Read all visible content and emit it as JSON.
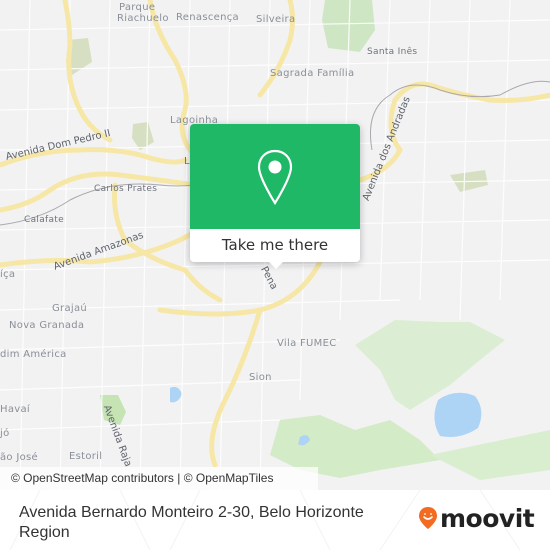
{
  "map": {
    "attribution": "© OpenStreetMap contributors | © OpenMapTiles",
    "neighborhoods": [
      {
        "name": "Parque",
        "id": "parque-riachuelo-1"
      },
      {
        "name": "Riachuelo",
        "id": "parque-riachuelo-2"
      },
      {
        "name": "Renascença",
        "id": "renascenca"
      },
      {
        "name": "Silveira",
        "id": "silveira"
      },
      {
        "name": "Santa Inês",
        "id": "santa-ines"
      },
      {
        "name": "Sagrada Família",
        "id": "sagrada-familia"
      },
      {
        "name": "Lagoinha",
        "id": "lagoinha"
      },
      {
        "name": "Carlos Prates",
        "id": "carlos-prates"
      },
      {
        "name": "Calafate",
        "id": "calafate"
      },
      {
        "name": "Grajaú",
        "id": "grajau"
      },
      {
        "name": "Nova Granada",
        "id": "nova-granada"
      },
      {
        "name": "dim América",
        "id": "jardim-america"
      },
      {
        "name": "Vila FUMEC",
        "id": "vila-fumec"
      },
      {
        "name": "Sion",
        "id": "sion"
      },
      {
        "name": "Havaí",
        "id": "havai"
      },
      {
        "name": "jó",
        "id": "jo"
      },
      {
        "name": "ão José",
        "id": "sao-jose"
      },
      {
        "name": "Estoril",
        "id": "estoril"
      },
      {
        "name": "íça",
        "id": "ica"
      },
      {
        "name": "L",
        "id": "l-fragment"
      }
    ],
    "roads": [
      {
        "name": "Avenida Dom Pedro II",
        "id": "dom-pedro"
      },
      {
        "name": "Avenida Amazonas",
        "id": "amazonas"
      },
      {
        "name": "Avenida dos Andradas",
        "id": "andradas"
      },
      {
        "name": "Avenida Raja",
        "id": "raja"
      },
      {
        "name": "Pena",
        "id": "pena"
      }
    ]
  },
  "popup": {
    "icon": "map-pin-icon",
    "button_label": "Take me there",
    "accent": "#1fb866"
  },
  "footer": {
    "address": "Avenida Bernardo Monteiro 2-30, Belo Horizonte Region",
    "logo_text": "moovit",
    "logo_color": "#f26b21"
  }
}
